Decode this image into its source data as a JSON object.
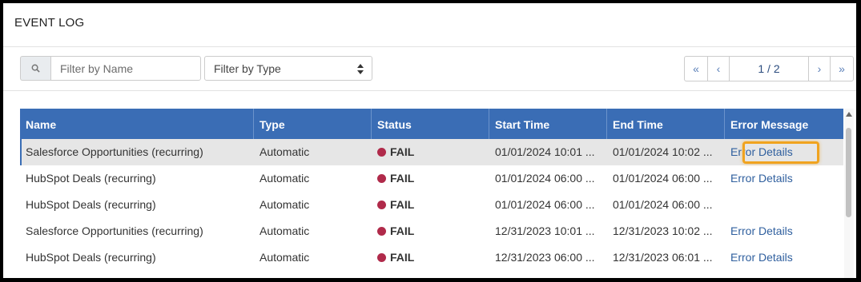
{
  "panel": {
    "title": "EVENT LOG"
  },
  "toolbar": {
    "search_placeholder": "Filter by Name",
    "type_filter_value": "Filter by Type",
    "pager": {
      "first": "«",
      "prev": "‹",
      "page": "1 / 2",
      "next": "›",
      "last": "»"
    }
  },
  "table": {
    "columns": [
      "Name",
      "Type",
      "Status",
      "Start Time",
      "End Time",
      "Error Message"
    ],
    "rows": [
      {
        "name": "Salesforce Opportunities (recurring)",
        "type": "Automatic",
        "status": "FAIL",
        "start": "01/01/2024 10:01 ...",
        "end": "01/01/2024 10:02 ...",
        "error": "Error Details",
        "selected": true
      },
      {
        "name": "HubSpot Deals (recurring)",
        "type": "Automatic",
        "status": "FAIL",
        "start": "01/01/2024 06:00 ...",
        "end": "01/01/2024 06:00 ...",
        "error": "Error Details"
      },
      {
        "name": "HubSpot Deals (recurring)",
        "type": "Automatic",
        "status": "FAIL",
        "start": "01/01/2024 06:00 ...",
        "end": "01/01/2024 06:00 ...",
        "error": ""
      },
      {
        "name": "Salesforce Opportunities (recurring)",
        "type": "Automatic",
        "status": "FAIL",
        "start": "12/31/2023 10:01 ...",
        "end": "12/31/2023 10:02 ...",
        "error": "Error Details"
      },
      {
        "name": "HubSpot Deals (recurring)",
        "type": "Automatic",
        "status": "FAIL",
        "start": "12/31/2023 06:00 ...",
        "end": "12/31/2023 06:01 ...",
        "error": "Error Details"
      }
    ]
  },
  "colors": {
    "header_bg": "#3a6db5",
    "fail_dot": "#b02a4a",
    "link": "#2f5f9e",
    "highlight": "#f0a31f"
  },
  "icons": {
    "search": "search-icon",
    "select_arrows": "sort-arrows-icon"
  }
}
